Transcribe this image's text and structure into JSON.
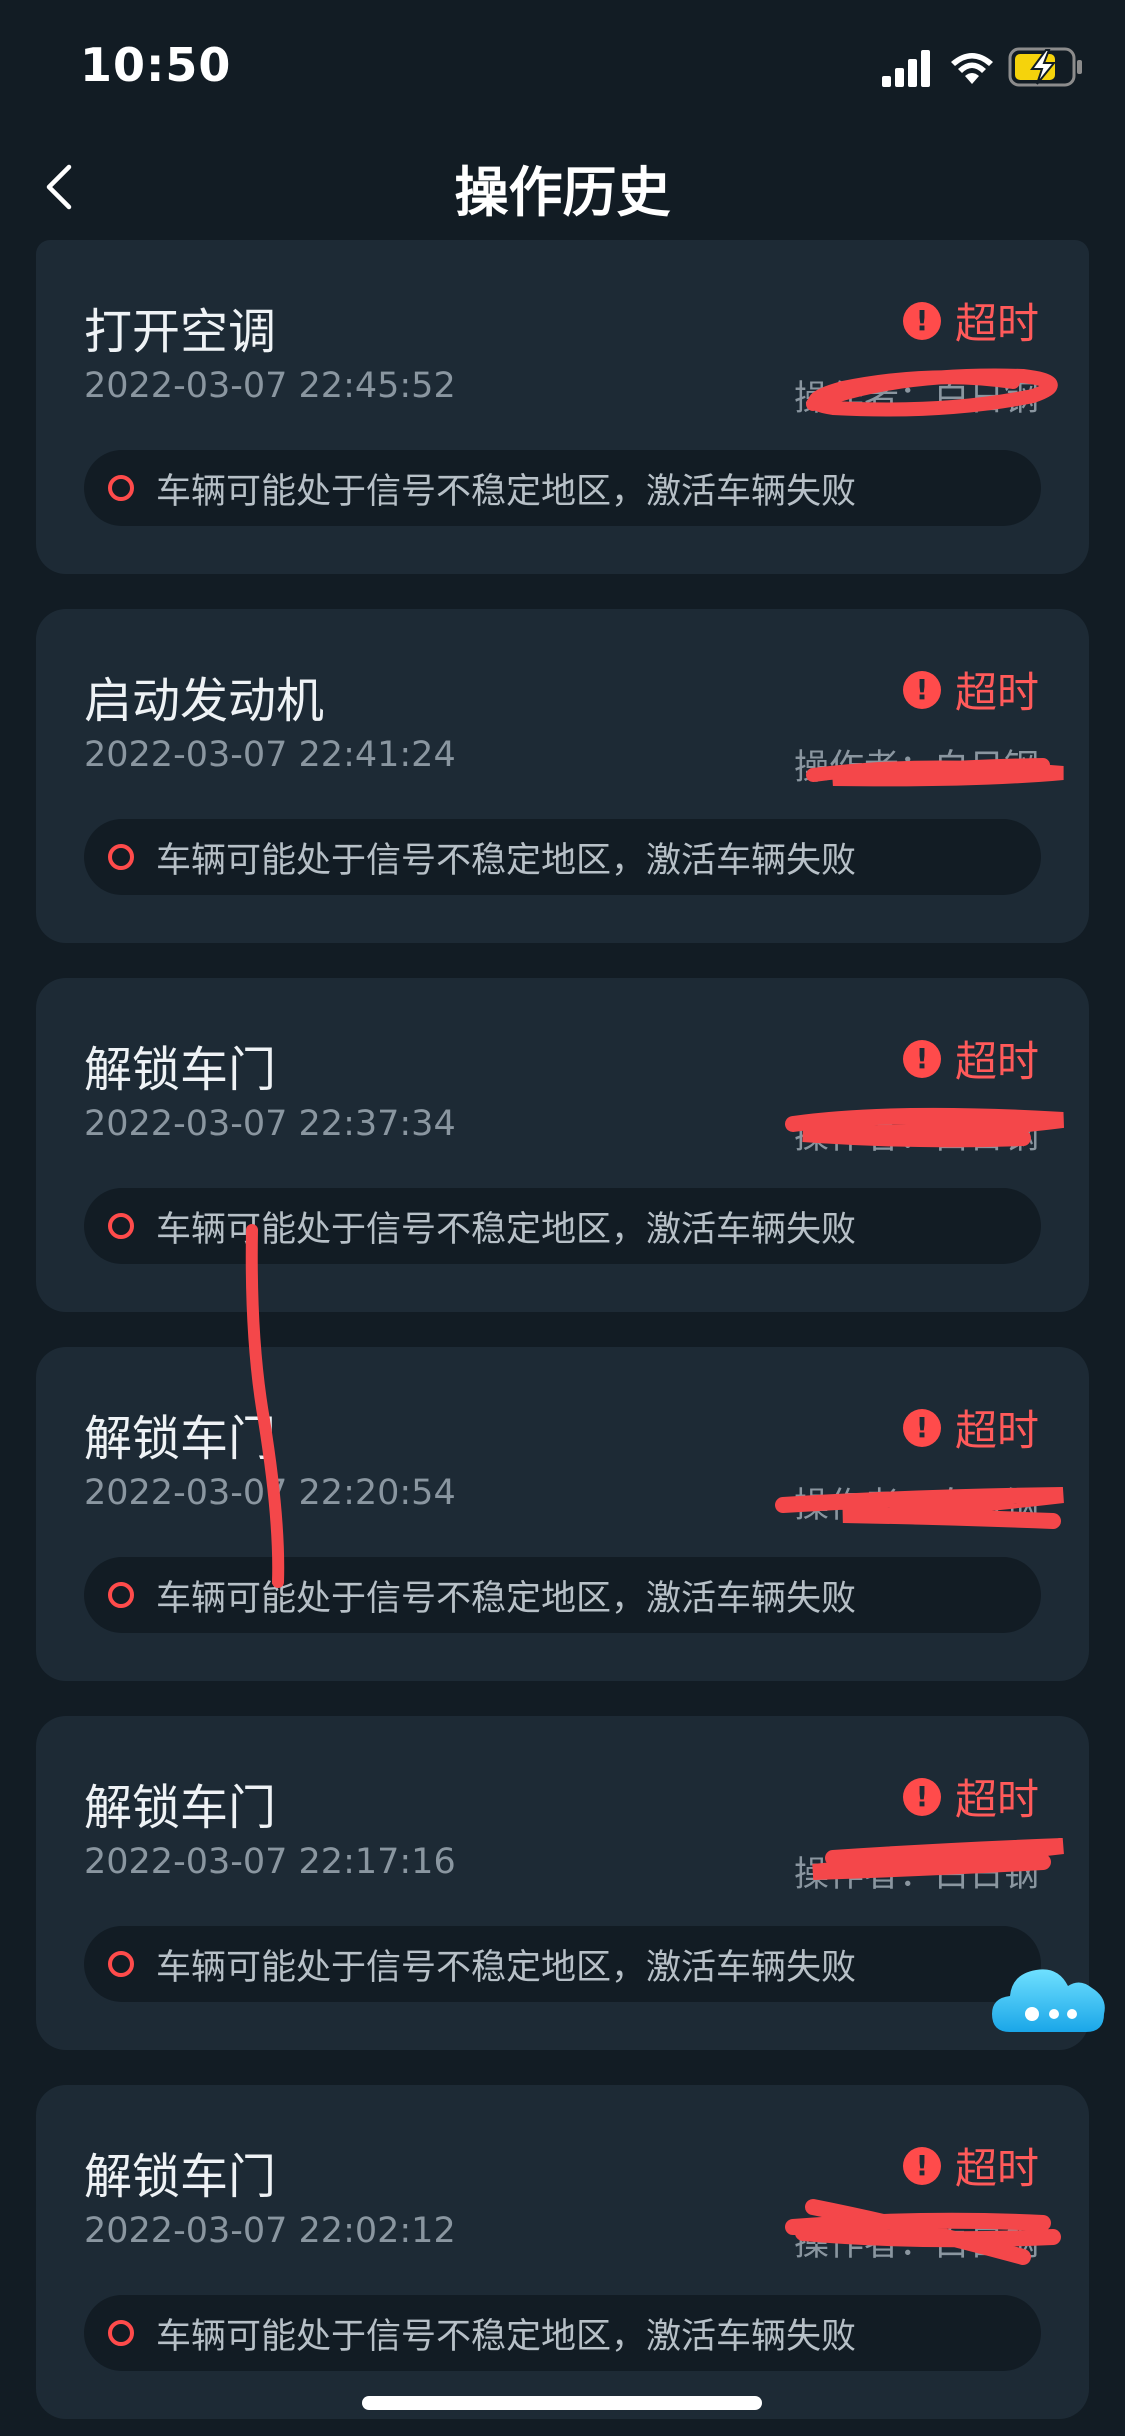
{
  "status_bar": {
    "time": "10:50"
  },
  "nav": {
    "title": "操作历史",
    "back_icon": "chevron-left-icon"
  },
  "colors": {
    "background": "#121c24",
    "card": "#1d2a35",
    "accent_red": "#ff4b4b",
    "text_secondary": "#8a96a0"
  },
  "records": [
    {
      "title": "打开空调",
      "time": "2022-03-07 22:45:52",
      "status": "超时",
      "operator": "操作者：白日钢",
      "reason": "车辆可能处于信号不稳定地区，激活车辆失败"
    },
    {
      "title": "启动发动机",
      "time": "2022-03-07 22:41:24",
      "status": "超时",
      "operator": "操作者：白日钢",
      "reason": "车辆可能处于信号不稳定地区，激活车辆失败"
    },
    {
      "title": "解锁车门",
      "time": "2022-03-07 22:37:34",
      "status": "超时",
      "operator": "操作者：白日钢",
      "reason": "车辆可能处于信号不稳定地区，激活车辆失败"
    },
    {
      "title": "解锁车门",
      "time": "2022-03-07 22:20:54",
      "status": "超时",
      "operator": "操作者：白日钢",
      "reason": "车辆可能处于信号不稳定地区，激活车辆失败"
    },
    {
      "title": "解锁车门",
      "time": "2022-03-07 22:17:16",
      "status": "超时",
      "operator": "操作者：白日钢",
      "reason": "车辆可能处于信号不稳定地区，激活车辆失败"
    },
    {
      "title": "解锁车门",
      "time": "2022-03-07 22:02:12",
      "status": "超时",
      "operator": "操作者：白日钢",
      "reason": "车辆可能处于信号不稳定地区，激活车辆失败"
    }
  ]
}
